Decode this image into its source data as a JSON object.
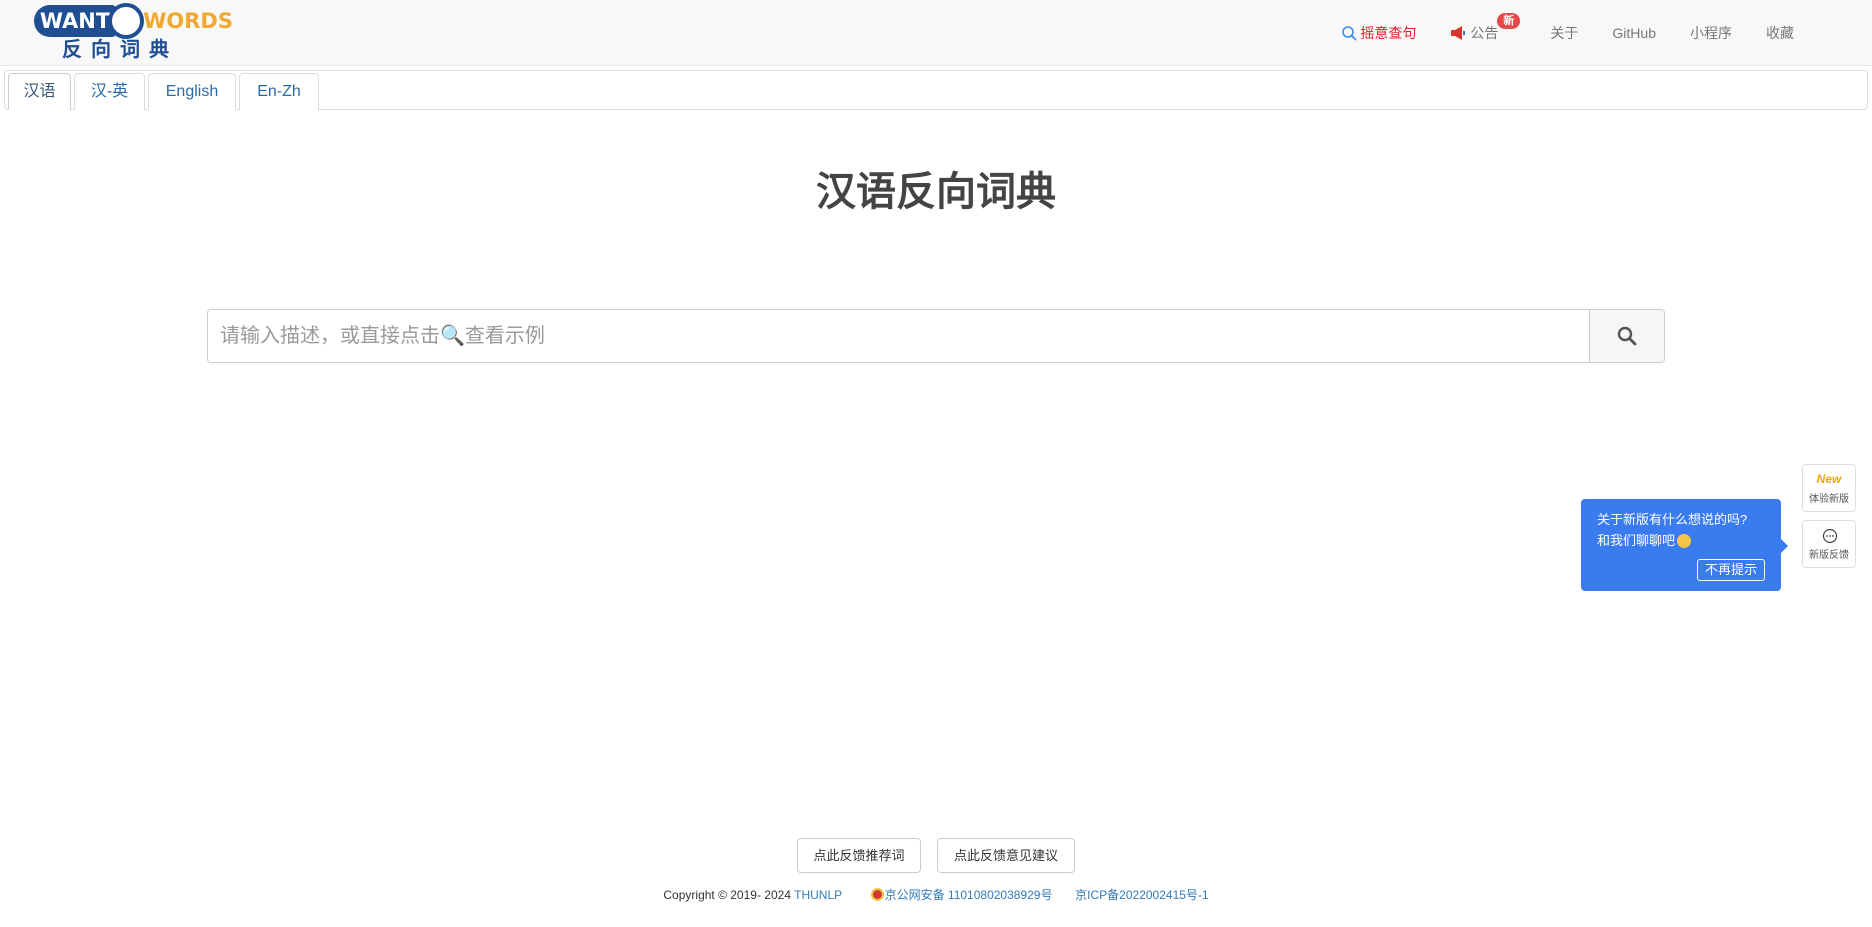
{
  "logo": {
    "want": "WANT",
    "words": "WORDS",
    "cn": "反向词典"
  },
  "nav": {
    "highlight": "摇意查句",
    "notice": "公告",
    "notice_badge": "新",
    "about": "关于",
    "github": "GitHub",
    "miniprogram": "小程序",
    "favorites": "收藏"
  },
  "tabs": [
    {
      "label": "汉语",
      "active": true
    },
    {
      "label": "汉-英",
      "active": false
    },
    {
      "label": "English",
      "active": false
    },
    {
      "label": "En-Zh",
      "active": false
    }
  ],
  "main": {
    "title": "汉语反向词典"
  },
  "search": {
    "placeholder": "请输入描述，或直接点击🔍查看示例"
  },
  "side": {
    "new_glyph": "New",
    "try_new": "体验新版",
    "feedback_new": "新版反馈"
  },
  "tooltip": {
    "line1": "关于新版有什么想说的吗?",
    "line2": "和我们聊聊吧",
    "dismiss": "不再提示"
  },
  "footer": {
    "recommend_button": "点此反馈推荐词",
    "suggest_button": "点此反馈意见建议",
    "copyright": "Copyright © 2019- 2024",
    "org": "THUNLP",
    "police_reg": "京公网安备 11010802038929号",
    "icp": "京ICP备2022002415号-1"
  },
  "colors": {
    "accent_red": "#e0202a",
    "link_blue": "#337ab7",
    "tooltip_blue": "#3b7bf0",
    "logo_blue": "#1f4e93",
    "logo_orange": "#f0a830"
  }
}
